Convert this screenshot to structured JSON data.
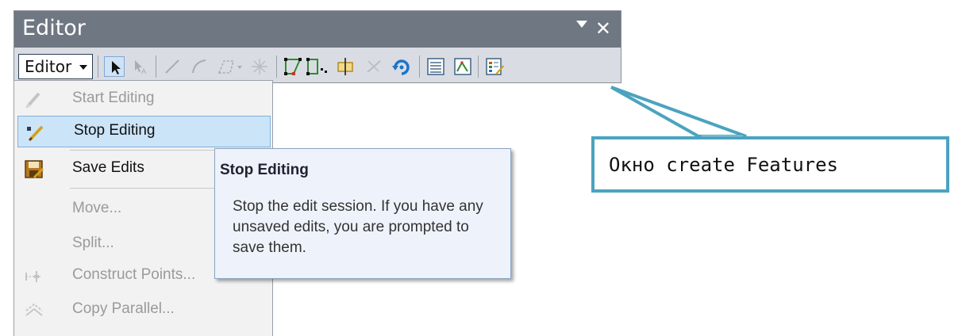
{
  "window": {
    "title": "Editor",
    "dropdown_icon": "chevron-down-icon",
    "close_icon": "close-icon"
  },
  "toolbar": {
    "editor_menu_label": "Editor",
    "tools": [
      {
        "name": "edit-tool-icon",
        "enabled": true
      },
      {
        "name": "edit-annotation-tool-icon",
        "enabled": false
      },
      {
        "name": "straight-segment-icon",
        "enabled": false
      },
      {
        "name": "end-point-arc-icon",
        "enabled": false
      },
      {
        "name": "trace-icon",
        "enabled": false
      },
      {
        "name": "point-icon",
        "enabled": false
      },
      {
        "name": "edit-vertices-icon",
        "enabled": true
      },
      {
        "name": "reshape-feature-icon",
        "enabled": true
      },
      {
        "name": "cut-polygons-icon",
        "enabled": true
      },
      {
        "name": "split-tool-icon",
        "enabled": false
      },
      {
        "name": "rotate-tool-icon",
        "enabled": true
      },
      {
        "name": "attributes-icon",
        "enabled": true
      },
      {
        "name": "sketch-properties-icon",
        "enabled": true
      },
      {
        "name": "create-features-icon",
        "enabled": true
      }
    ]
  },
  "menu": {
    "items": [
      {
        "label": "Start Editing",
        "icon": "start-editing-icon",
        "enabled": false
      },
      {
        "label": "Stop Editing",
        "icon": "stop-editing-icon",
        "enabled": true,
        "highlighted": true
      },
      {
        "label": "Save Edits",
        "icon": "save-edits-icon",
        "enabled": true
      },
      {
        "label": "Move...",
        "icon": "",
        "enabled": false
      },
      {
        "label": "Split...",
        "icon": "",
        "enabled": false
      },
      {
        "label": "Construct Points...",
        "icon": "construct-points-icon",
        "enabled": false
      },
      {
        "label": "Copy Parallel...",
        "icon": "copy-parallel-icon",
        "enabled": false
      }
    ]
  },
  "tooltip": {
    "title": "Stop Editing",
    "body": "Stop the edit session. If you have any unsaved edits, you are prompted to save them."
  },
  "callout": {
    "text": "Окно create Features",
    "color": "#4ba3bf"
  }
}
